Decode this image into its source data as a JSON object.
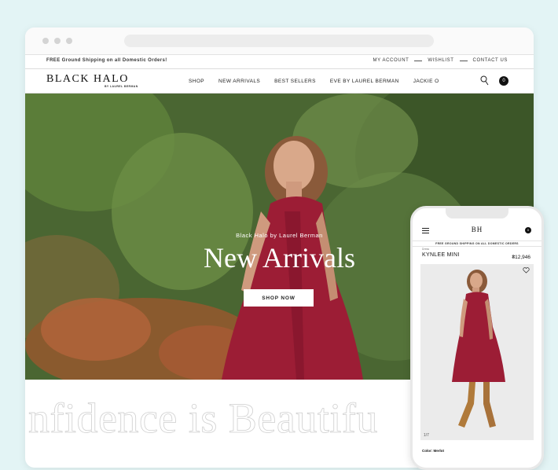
{
  "browser": {
    "promo": "FREE Ground Shipping on all Domestic Orders!",
    "utility_links": [
      "MY ACCOUNT",
      "WISHLIST",
      "CONTACT US"
    ]
  },
  "header": {
    "logo": "BLACK HALO",
    "logo_sub": "BY LAUREL BERMAN",
    "nav": [
      "SHOP",
      "NEW ARRIVALS",
      "BEST SELLERS",
      "EVE BY LAUREL BERMAN",
      "JACKIE O"
    ],
    "bag_count": "0",
    "icons": [
      "search-icon",
      "bag-icon"
    ]
  },
  "hero": {
    "subtitle": "Black Halo by Laurel Berman",
    "title": "New Arrivals",
    "cta": "SHOP NOW"
  },
  "slogan": "nfidence is Beautifu",
  "mobile": {
    "logo": "BH",
    "bag_count": "0",
    "promo": "FREE GROUND SHIPPING ON ALL DOMESTIC ORDERS",
    "breadcrumb": "Dress",
    "product_name": "KYNLEE MINI",
    "price": "₴12,946",
    "image_counter": "1/7",
    "color_label": "Color: Merlot",
    "icons": [
      "menu-icon",
      "bag-icon",
      "heart-icon"
    ]
  },
  "colors": {
    "background": "#e3f4f5",
    "dress": "#9c1d35",
    "foliage": "#4e6e34"
  }
}
